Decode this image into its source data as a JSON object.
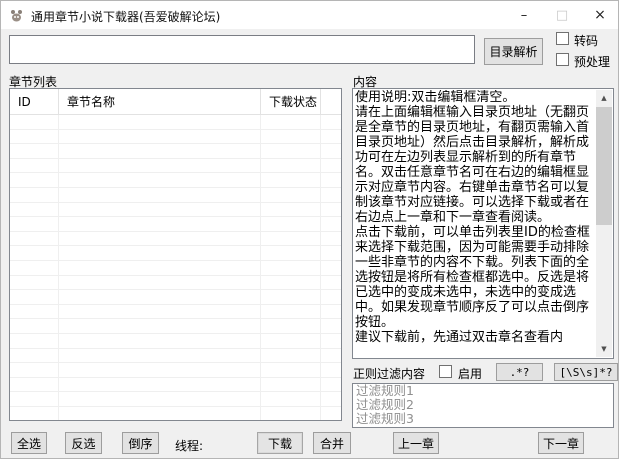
{
  "window": {
    "title": "通用章节小说下载器(吾爱破解论坛)",
    "controls": {
      "minimize": "–",
      "maximize": "□",
      "close": "×"
    }
  },
  "toolbar": {
    "url_input": {
      "value": "",
      "placeholder": ""
    },
    "parse_button": "目录解析",
    "transcode_checkbox": {
      "label": "转码",
      "checked": false
    },
    "preprocess_checkbox": {
      "label": "预处理",
      "checked": false
    }
  },
  "chapter_list": {
    "label": "章节列表",
    "columns": [
      "ID",
      "章节名称",
      "下载状态",
      ""
    ],
    "rows": []
  },
  "content": {
    "label": "内容",
    "text": "使用说明:双击编辑框清空。\n请在上面编辑框输入目录页地址（无翻页是全章节的目录页地址，有翻页需输入首目录页地址）然后点击目录解析，解析成功可在左边列表显示解析到的所有章节名。双击任意章节名可在右边的编辑框显示对应章节内容。右键单击章节名可以复制该章节对应链接。可以选择下载或者在右边点上一章和下一章查看阅读。\n点击下载前，可以单击列表里ID的检查框来选择下载范围，因为可能需要手动排除一些非章节的内容不下载。列表下面的全选按钮是将所有检查框都选中。反选是将已选中的变成未选中，未选中的变成选中。如果发现章节顺序反了可以点击倒序按钮。\n建议下载前，先通过双击章名查看内",
    "scroll_icons": {
      "up": "▲",
      "down": "▼"
    }
  },
  "regex_filter": {
    "label": "正则过滤内容",
    "enable_checkbox": {
      "label": "启用",
      "checked": false
    },
    "preset_button_1": ".*?",
    "preset_button_2": "[\\S\\s]*?",
    "rules_list": [
      "过滤规则1",
      "过滤规则2",
      "过滤规则3"
    ]
  },
  "bottom_bar": {
    "select_all": "全选",
    "invert_selection": "反选",
    "reverse_order": "倒序",
    "threads_label": "线程:",
    "download": "下载",
    "merge": "合并",
    "prev_chapter": "上一章",
    "next_chapter": "下一章"
  },
  "colors": {
    "window_bg": "#f0f0f0",
    "titlebar_bg": "#ffffff",
    "control_border": "#82878f",
    "button_bg": "#e2e2e2",
    "button_border": "#9d9d9d",
    "grid_line": "#efefef",
    "muted_text": "#8f8f8f"
  }
}
